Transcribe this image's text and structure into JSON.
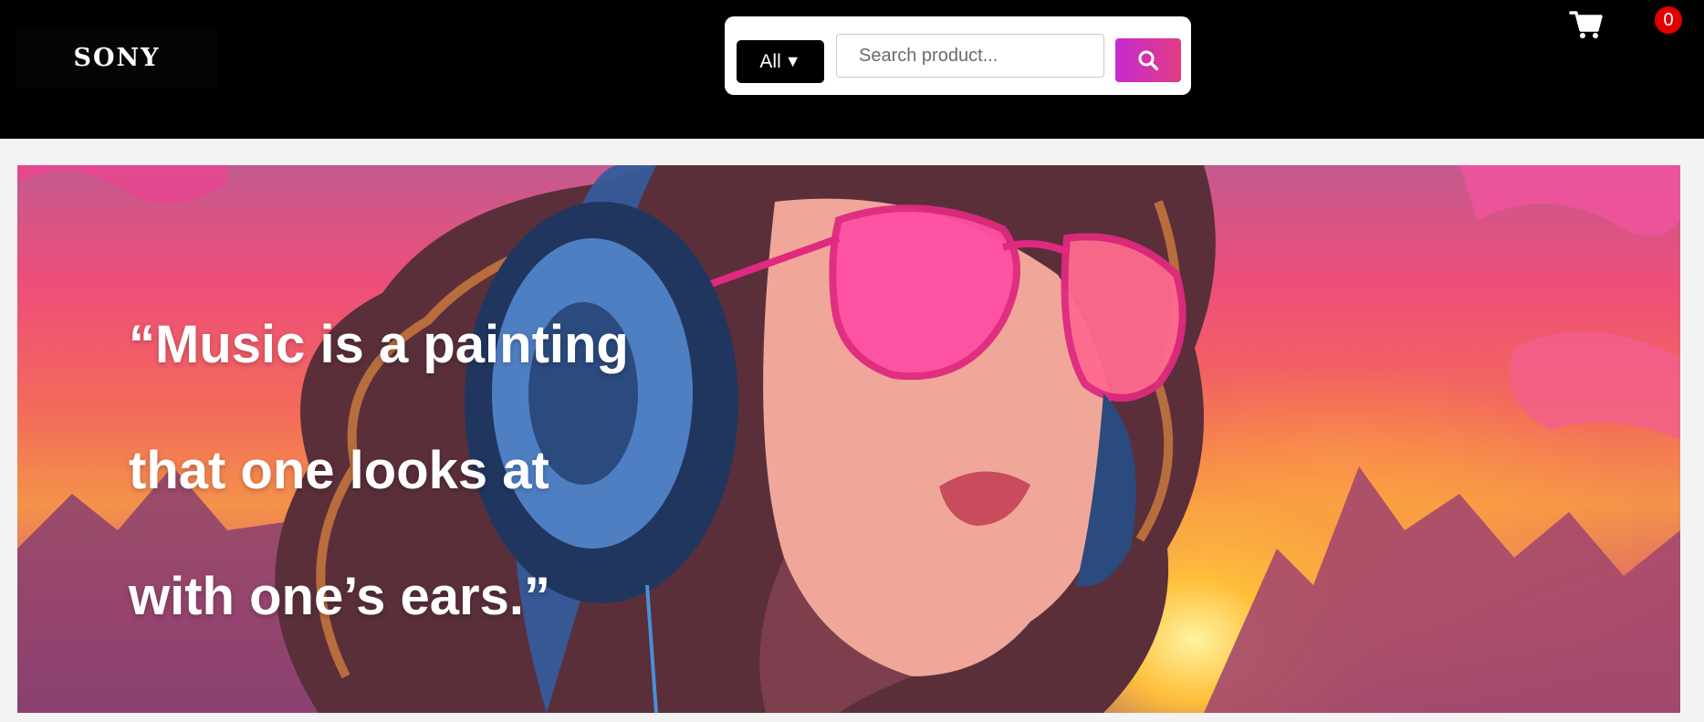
{
  "header": {
    "logo": "SONY",
    "category_select": {
      "label": "All",
      "arrow": "▼"
    },
    "search": {
      "placeholder": "Search product...",
      "value": "",
      "button_icon": "search-icon"
    },
    "cart": {
      "icon": "cart-icon",
      "count": "0"
    }
  },
  "hero": {
    "quote_lines": [
      "“Music is a painting",
      "that one looks at",
      "with one’s ears.”"
    ],
    "image_description_icon": "woman-headphones-sunglasses-illustration"
  },
  "colors": {
    "header_bg": "#000000",
    "search_button_gradient": [
      "#c52ad0",
      "#e23c83"
    ],
    "badge": "#e00000",
    "page_bg": "#f3f3f3"
  }
}
